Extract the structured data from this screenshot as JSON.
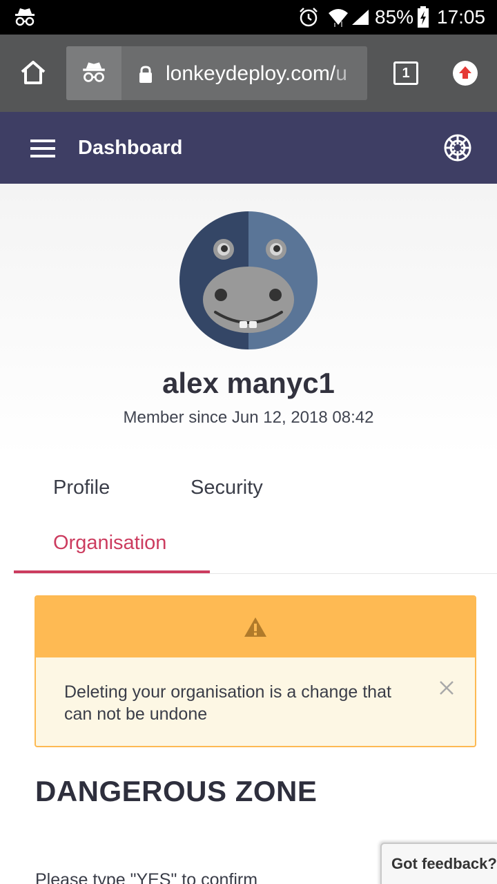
{
  "status_bar": {
    "battery_percent": "85%",
    "time": "17:05",
    "icons": [
      "incognito-icon",
      "alarm-icon",
      "wifi-icon",
      "signal-icon",
      "battery-charging-icon"
    ]
  },
  "browser": {
    "url": "lonkeydeploy.com/",
    "url_tail": "u",
    "tab_count": "1",
    "icons": [
      "home-icon",
      "incognito-icon",
      "lock-icon",
      "update-icon"
    ]
  },
  "header": {
    "title": "Dashboard",
    "icons": [
      "hamburger-menu-icon",
      "help-icon"
    ],
    "color": "#3e3e64"
  },
  "profile": {
    "name": "alex manyc1",
    "member_since": "Member since Jun 12, 2018 08:42"
  },
  "tabs": [
    {
      "label": "Profile",
      "active": false
    },
    {
      "label": "Security",
      "active": false
    },
    {
      "label": "Organisation",
      "active": true
    }
  ],
  "alert": {
    "message": "Deleting your organisation is a change that can not be undone",
    "icons": [
      "warning-icon",
      "close-icon"
    ],
    "header_color": "#feba53"
  },
  "danger": {
    "title": "DANGEROUS ZONE",
    "confirm_text": "Please type \"YES\" to confirm"
  },
  "feedback": {
    "label": "Got feedback?"
  },
  "accent_color": "#cc3c5f"
}
